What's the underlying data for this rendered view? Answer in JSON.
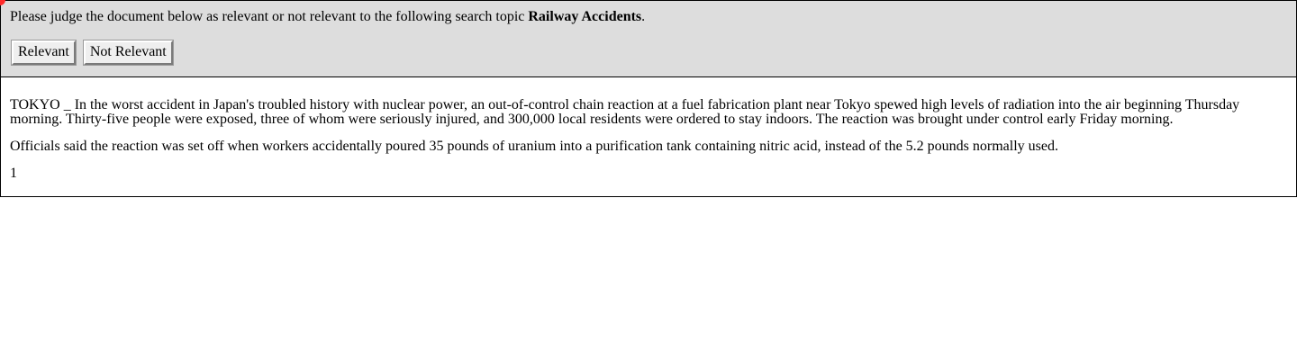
{
  "judge": {
    "prompt_prefix": "Please judge the document below as relevant or not relevant to the following search topic ",
    "topic": "Railway Accidents",
    "prompt_suffix": ".",
    "relevant_label": "Relevant",
    "not_relevant_label": "Not Relevant"
  },
  "document": {
    "paragraphs": [
      "TOKYO _ In the worst accident in Japan's troubled history with nuclear power, an out-of-control chain reaction at a fuel fabrication plant near Tokyo spewed high levels of radiation into the air beginning Thursday morning. Thirty-five people were exposed, three of whom were seriously injured, and 300,000 local residents were ordered to stay indoors. The reaction was brought under control early Friday morning.",
      "Officials said the reaction was set off when workers accidentally poured 35 pounds of uranium into a purification tank containing nitric acid, instead of the 5.2 pounds normally used."
    ],
    "page_number": "1"
  },
  "colors": {
    "panel_background": "#dddddd",
    "border": "#000000",
    "corner_dot": "#ff2a2a"
  }
}
